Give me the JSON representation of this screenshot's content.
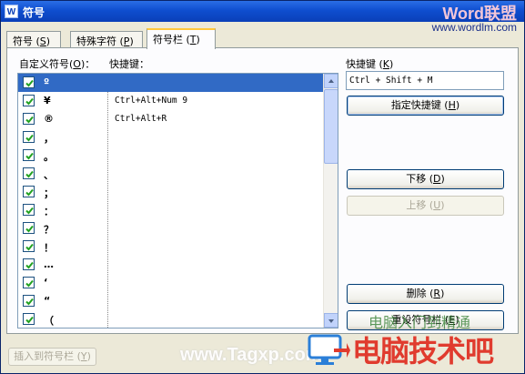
{
  "window": {
    "title": "符号",
    "icon_glyph": "W"
  },
  "watermark": {
    "brand": "Word联盟",
    "url": "www.wordlm.com",
    "site": "www.Tagxp.com",
    "tagline": "电脑入门到精通",
    "big": "电脑技术吧"
  },
  "tabs": [
    {
      "label": "符号",
      "key": "S"
    },
    {
      "label": "特殊字符",
      "key": "P"
    },
    {
      "label": "符号栏",
      "key": "T"
    }
  ],
  "list": {
    "header_symbol": "自定义符号",
    "header_symbol_key": "O",
    "header_shortcut": "快捷键：",
    "rows": [
      {
        "symbol": "º",
        "shortcut": ""
      },
      {
        "symbol": "¥",
        "shortcut": "Ctrl+Alt+Num 9"
      },
      {
        "symbol": "®",
        "shortcut": "Ctrl+Alt+R"
      },
      {
        "symbol": "，",
        "shortcut": ""
      },
      {
        "symbol": "。",
        "shortcut": ""
      },
      {
        "symbol": "、",
        "shortcut": ""
      },
      {
        "symbol": "；",
        "shortcut": ""
      },
      {
        "symbol": "：",
        "shortcut": ""
      },
      {
        "symbol": "？",
        "shortcut": ""
      },
      {
        "symbol": "！",
        "shortcut": ""
      },
      {
        "symbol": "…",
        "shortcut": ""
      },
      {
        "symbol": "‘",
        "shortcut": ""
      },
      {
        "symbol": "“",
        "shortcut": ""
      },
      {
        "symbol": "（",
        "shortcut": ""
      }
    ]
  },
  "right": {
    "shortcut_label": "快捷键",
    "shortcut_label_key": "K",
    "shortcut_value": "Ctrl + Shift + M",
    "assign_button": "指定快捷键",
    "assign_key": "H",
    "down_button": "下移",
    "down_key": "D",
    "up_button": "上移",
    "up_key": "U",
    "delete_button": "删除",
    "delete_key": "R",
    "reset_button": "重设符号栏",
    "reset_key": "E"
  },
  "footer": {
    "insert_button": "插入到符号栏",
    "insert_key": "Y"
  },
  "colors": {
    "selection": "#316ac5",
    "title_bar": "#0f4ecf",
    "checkbox_check": "#21a121"
  }
}
